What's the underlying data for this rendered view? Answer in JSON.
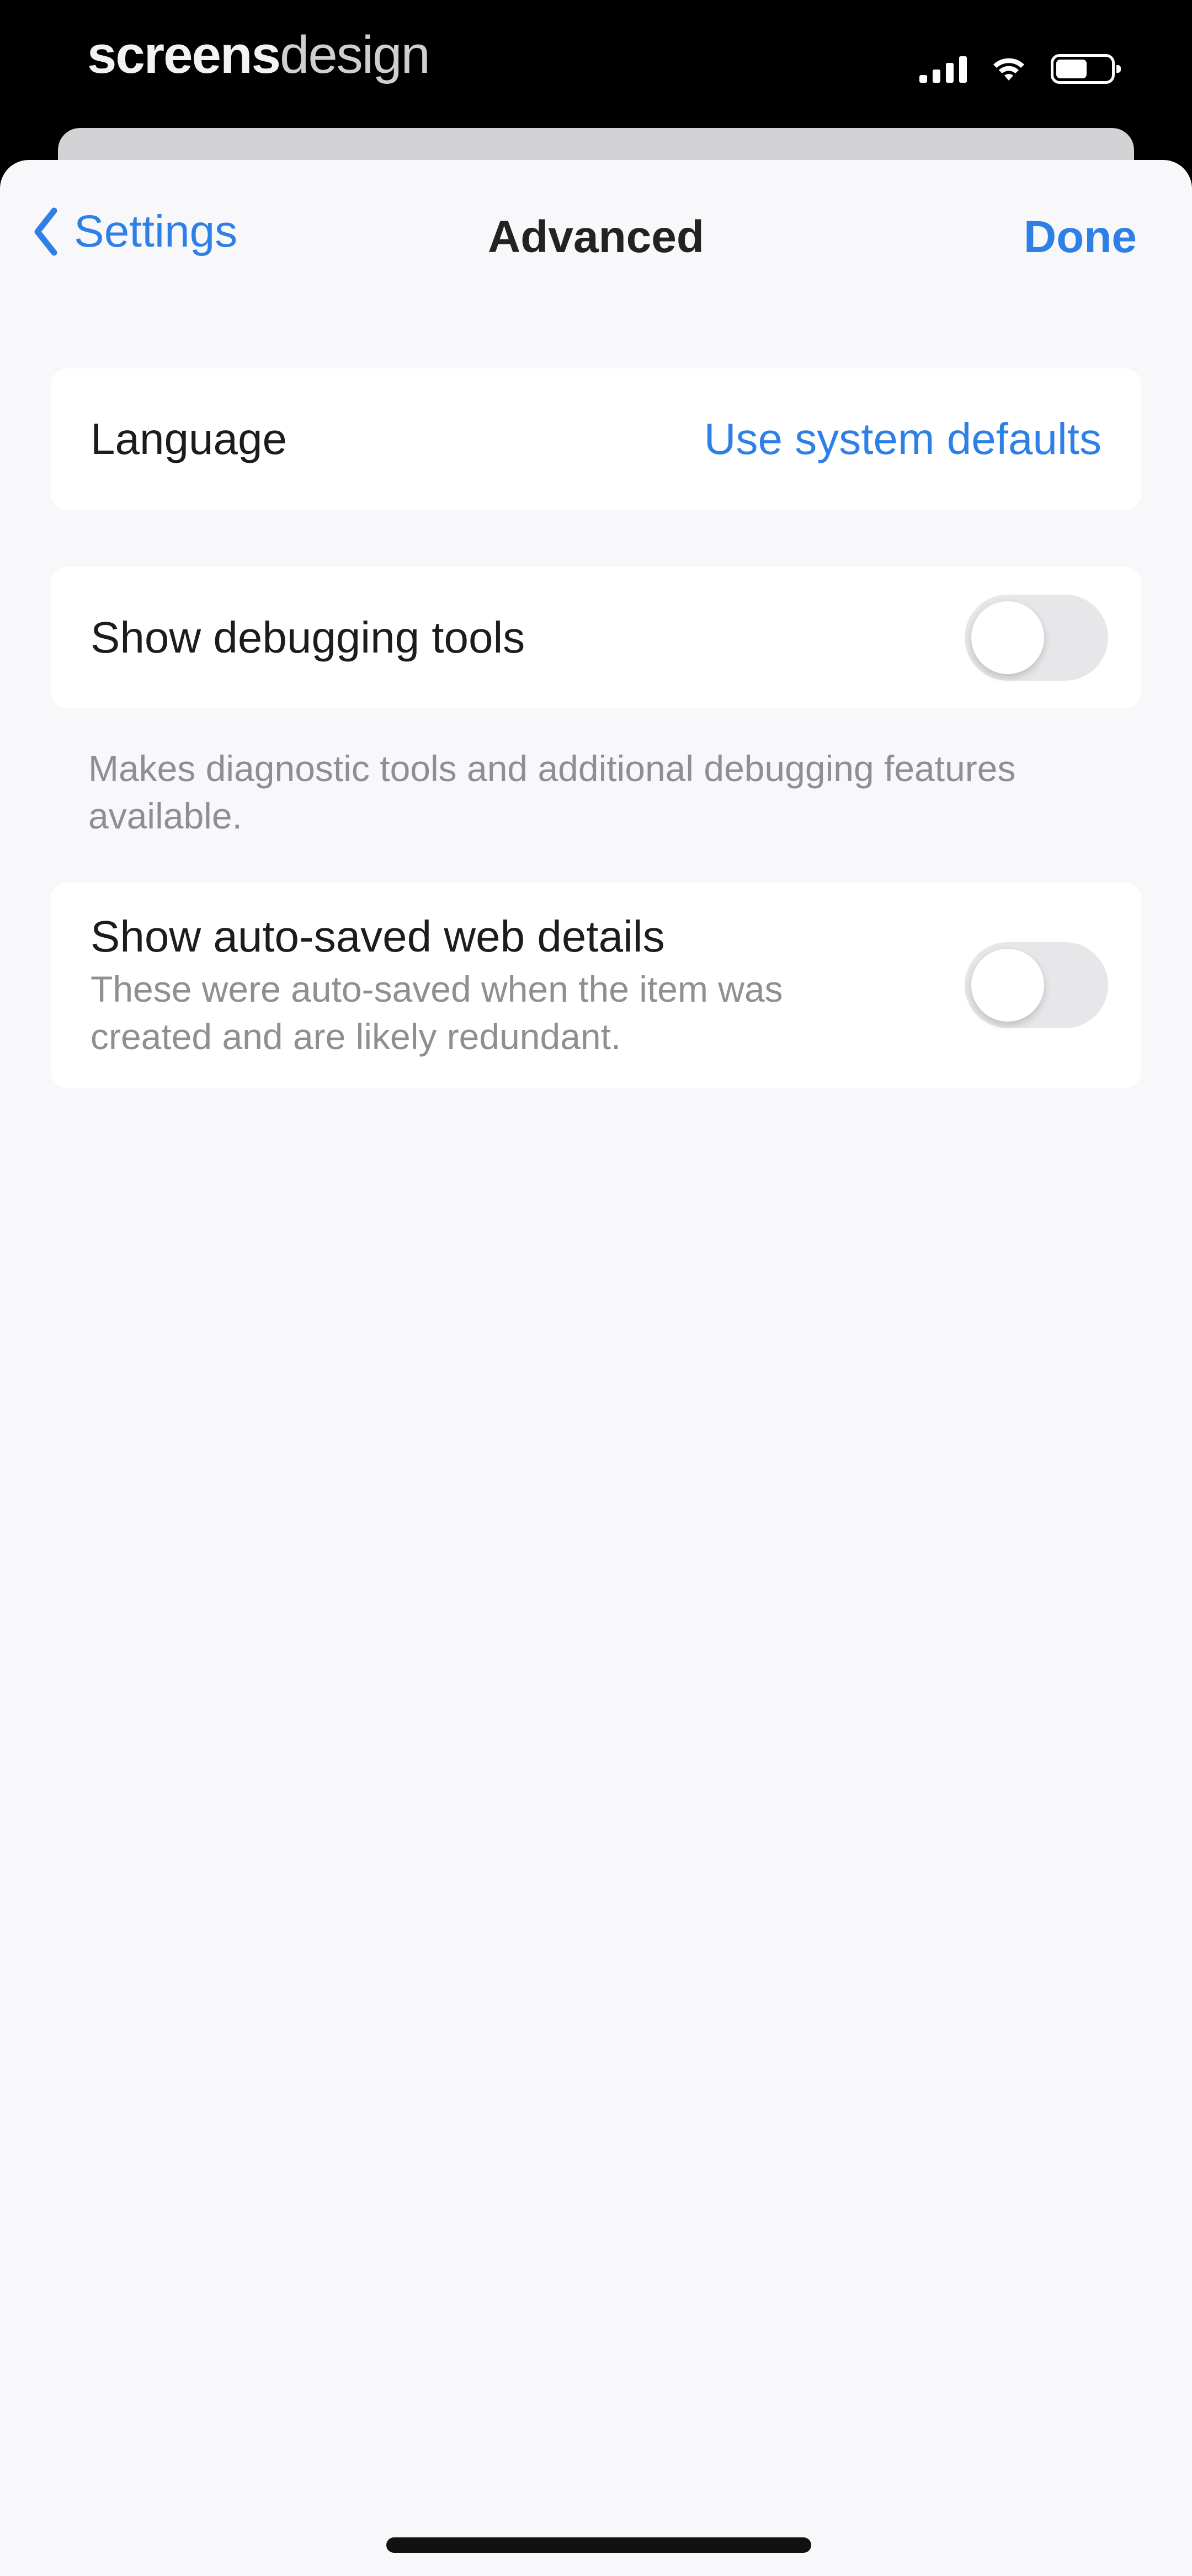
{
  "status_bar": {
    "watermark_bold": "screens",
    "watermark_light": "design",
    "icons": [
      "cellular-signal-icon",
      "wifi-icon",
      "battery-icon"
    ],
    "battery_level": 0.55
  },
  "nav": {
    "back_label": "Settings",
    "title": "Advanced",
    "done_label": "Done"
  },
  "language_row": {
    "label": "Language",
    "value": "Use system defaults"
  },
  "debugging_row": {
    "label": "Show debugging tools",
    "enabled": false,
    "footnote": "Makes diagnostic tools and additional debugging features available."
  },
  "autosave_row": {
    "label": "Show auto-saved web details",
    "subtitle": "These were auto-saved when the item was created and are likely redundant.",
    "enabled": false
  },
  "colors": {
    "accent": "#2f80e6",
    "background": "#f8f7fa",
    "toggle_off": "#e7e7ea"
  }
}
